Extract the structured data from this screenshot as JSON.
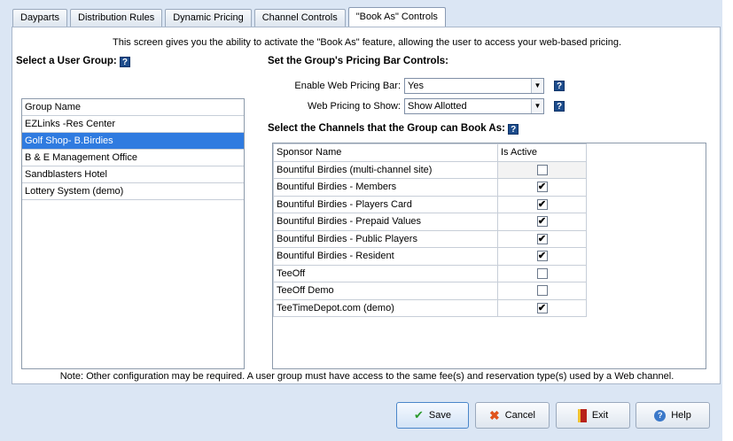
{
  "tabs": [
    {
      "label": "Dayparts"
    },
    {
      "label": "Distribution Rules"
    },
    {
      "label": "Dynamic Pricing"
    },
    {
      "label": "Channel Controls"
    },
    {
      "label": "\"Book As\" Controls"
    }
  ],
  "active_tab": 4,
  "intro": "This screen gives you the ability to activate the \"Book As\" feature, allowing the user to access your web-based pricing.",
  "user_group": {
    "title": "Select a User Group:",
    "column_header": "Group Name",
    "items": [
      {
        "label": "EZLinks -Res Center",
        "selected": false
      },
      {
        "label": "Golf Shop- B.Birdies",
        "selected": true
      },
      {
        "label": "B & E Management Office",
        "selected": false
      },
      {
        "label": "Sandblasters Hotel",
        "selected": false
      },
      {
        "label": "Lottery System (demo)",
        "selected": false
      }
    ]
  },
  "pricing_bar": {
    "title": "Set the Group's Pricing Bar Controls:",
    "enable_label": "Enable Web Pricing Bar:",
    "enable_value": "Yes",
    "show_label": "Web Pricing to Show:",
    "show_value": "Show Allotted"
  },
  "channels": {
    "title": "Select the Channels that the Group can Book As:",
    "col_sponsor": "Sponsor Name",
    "col_active": "Is Active",
    "rows": [
      {
        "name": "Bountiful Birdies (multi-channel site)",
        "active": false
      },
      {
        "name": "Bountiful Birdies - Members",
        "active": true
      },
      {
        "name": "Bountiful Birdies - Players Card",
        "active": true
      },
      {
        "name": "Bountiful Birdies - Prepaid Values",
        "active": true
      },
      {
        "name": "Bountiful Birdies - Public Players",
        "active": true
      },
      {
        "name": "Bountiful Birdies - Resident",
        "active": true
      },
      {
        "name": "TeeOff",
        "active": false
      },
      {
        "name": "TeeOff Demo",
        "active": false
      },
      {
        "name": "TeeTimeDepot.com (demo)",
        "active": true
      }
    ]
  },
  "note": "Note: Other configuration may be required.  A user group must have access to the same fee(s) and reservation type(s) used by a Web channel.",
  "buttons": {
    "save": "Save",
    "cancel": "Cancel",
    "exit": "Exit",
    "help": "Help"
  },
  "icons": {
    "help": "?",
    "checkmark": "✔",
    "dropdown": "▼"
  },
  "colors": {
    "selected_row": "#2f7be0",
    "help_icon": "#1d4c8c",
    "background": "#dbe6f4"
  }
}
